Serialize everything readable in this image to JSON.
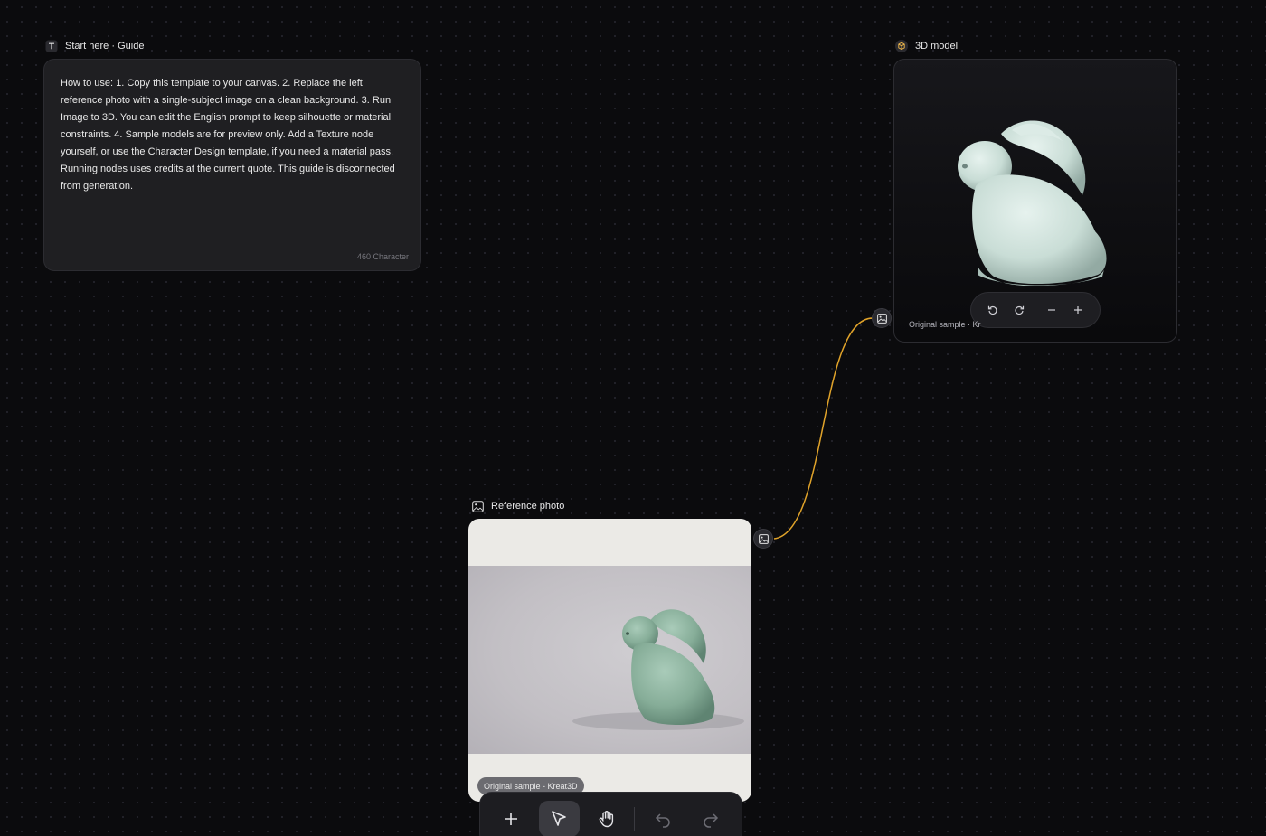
{
  "guide_node": {
    "title": "Start here · Guide",
    "body": "How to use: 1. Copy this template to your canvas. 2. Replace the left reference photo with a single-subject image on a clean background. 3. Run Image to 3D. You can edit the English prompt to keep silhouette or material constraints. 4. Sample models are for preview only. Add a Texture node yourself, or use the Character Design template, if you need a material pass. Running nodes uses credits at the current quote. This guide is disconnected from generation.",
    "char_count": "460 Character",
    "icon": "text-icon"
  },
  "model_node": {
    "title": "3D model",
    "caption": "Original sample · Kr",
    "icon": "cube-icon",
    "controls": [
      "rotate-left-icon",
      "rotate-right-icon",
      "zoom-out-icon",
      "zoom-in-icon"
    ]
  },
  "photo_node": {
    "title": "Reference photo",
    "caption": "Original sample - Kreat3D",
    "icon": "image-icon"
  },
  "connection": {
    "color": "#e0a32a"
  },
  "toolbar": {
    "tools": [
      "add-icon",
      "select-cursor-icon",
      "hand-pan-icon",
      "undo-icon",
      "redo-icon"
    ],
    "active": "select-cursor-icon"
  },
  "colors": {
    "canvas": "#0b0b0d",
    "node": "#1f1f22",
    "accent": "#e0a32a",
    "model_tint": "#cfe3dc"
  }
}
